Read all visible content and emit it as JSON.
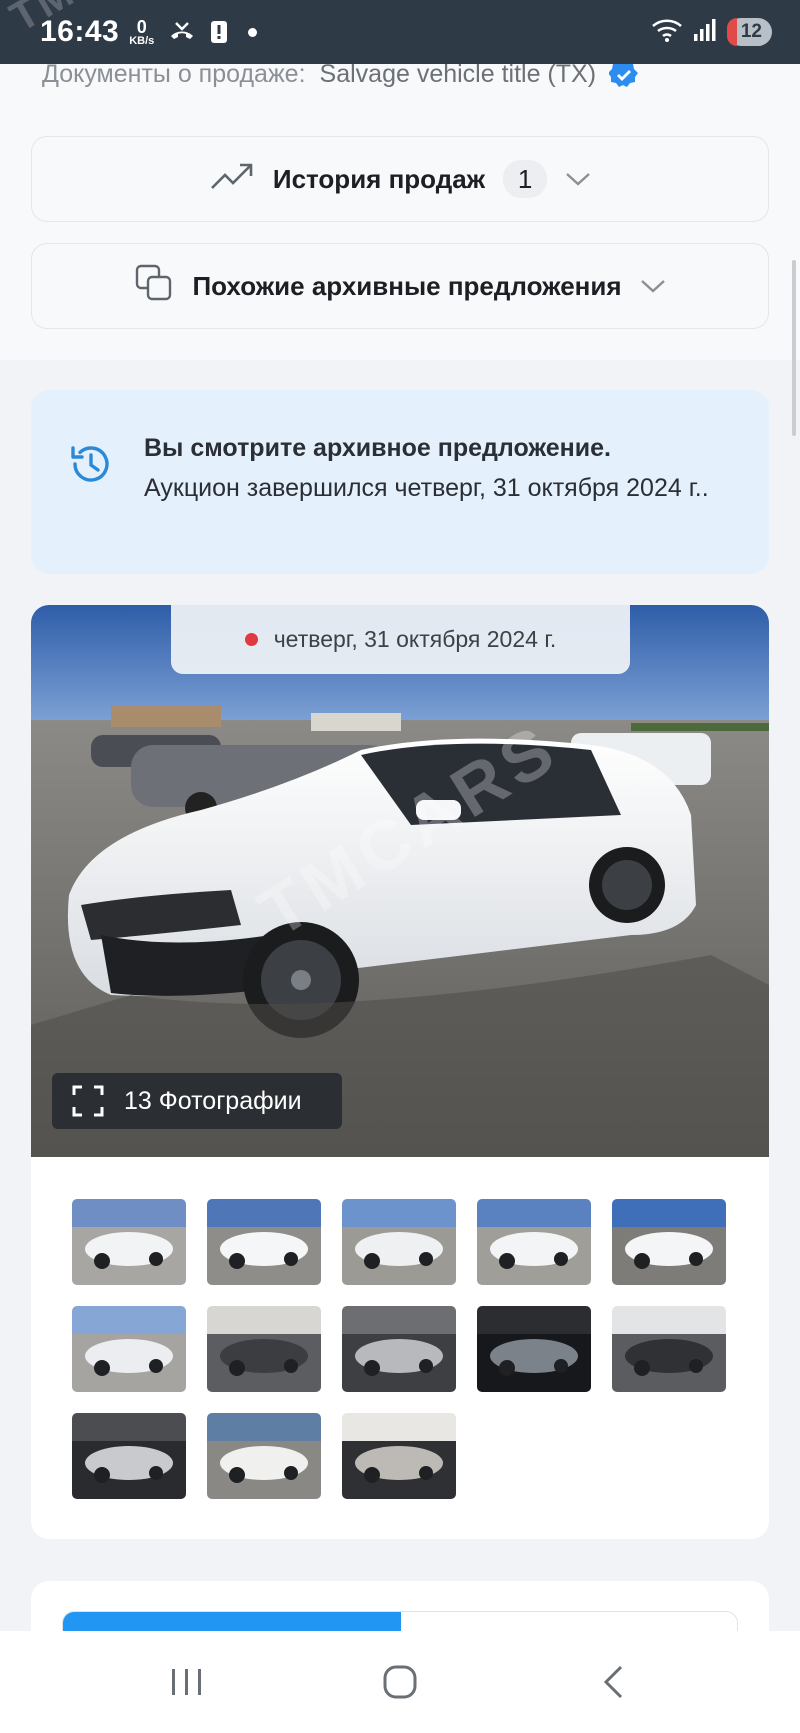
{
  "status_bar": {
    "time": "16:43",
    "net_speed_value": "0",
    "net_speed_unit": "KB/s",
    "battery": "12",
    "watermark": "TMC"
  },
  "listing": {
    "docs_label": "Документы о продаже:",
    "docs_value": "Salvage vehicle title (TX)",
    "sales_history_label": "История продаж",
    "sales_history_count": "1",
    "similar_archive_label": "Похожие архивные предложения"
  },
  "archive_notice": {
    "title": "Вы смотрите архивное предложение.",
    "body": "Аукцион завершился четверг, 31 октября 2024 г.."
  },
  "gallery": {
    "auction_date": "четверг, 31 октября 2024 г.",
    "photos_button": "13 Фотографии",
    "watermark": "TMCARS",
    "thumbnails": [
      {
        "name": "front-left-exterior"
      },
      {
        "name": "left-side-exterior"
      },
      {
        "name": "rear-right-exterior"
      },
      {
        "name": "right-side-exterior"
      },
      {
        "name": "front-exterior"
      },
      {
        "name": "rear-exterior"
      },
      {
        "name": "interior-front-seats"
      },
      {
        "name": "dashboard"
      },
      {
        "name": "instrument-cluster"
      },
      {
        "name": "interior-rear-seats"
      },
      {
        "name": "engine-bay"
      },
      {
        "name": "document-paper"
      },
      {
        "name": "vin-label"
      }
    ]
  },
  "colors": {
    "accent": "#2196f3",
    "notice_bg": "#e4f1fd",
    "status_bar": "#2f3a47",
    "live_dot": "#e0393e"
  },
  "nav_bar": {
    "recents": "recents-icon",
    "home": "home-icon",
    "back": "back-icon"
  }
}
